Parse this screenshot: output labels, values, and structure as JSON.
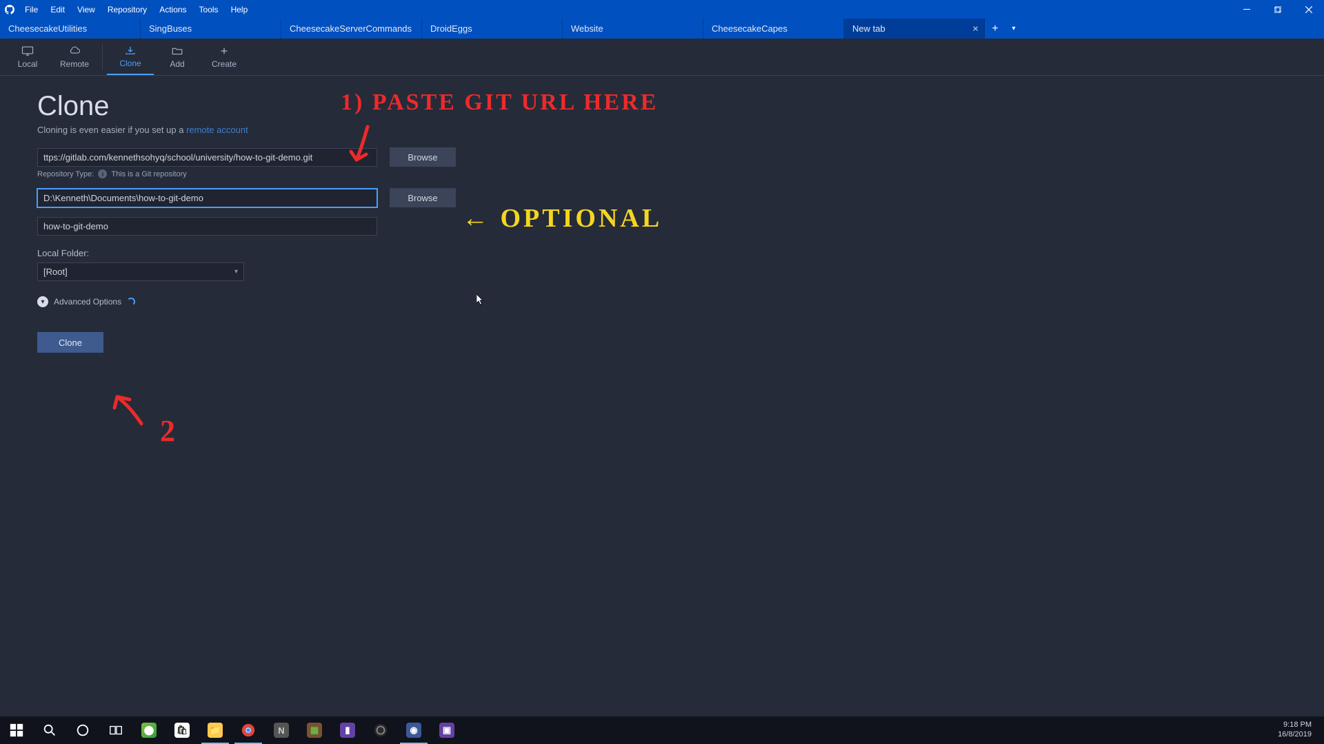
{
  "menubar": [
    "File",
    "Edit",
    "View",
    "Repository",
    "Actions",
    "Tools",
    "Help"
  ],
  "tabs": [
    {
      "label": "CheesecakeUtilities"
    },
    {
      "label": "SingBuses"
    },
    {
      "label": "CheesecakeServerCommands"
    },
    {
      "label": "DroidEggs"
    },
    {
      "label": "Website"
    },
    {
      "label": "CheesecakeCapes"
    },
    {
      "label": "New tab",
      "closable": true
    }
  ],
  "toolbar": {
    "local": "Local",
    "remote": "Remote",
    "clone": "Clone",
    "add": "Add",
    "create": "Create"
  },
  "page": {
    "title": "Clone",
    "subtitle_prefix": "Cloning is even easier if you set up a ",
    "subtitle_link": "remote account",
    "url_value": "ttps://gitlab.com/kennethsohyq/school/university/how-to-git-demo.git",
    "browse1": "Browse",
    "repo_type_label": "Repository Type:",
    "repo_type_desc": "This is a Git repository",
    "dest_value": "D:\\Kenneth\\Documents\\how-to-git-demo",
    "browse2": "Browse",
    "name_value": "how-to-git-demo",
    "local_folder_label": "Local Folder:",
    "root_option": "[Root]",
    "adv_options": "Advanced Options",
    "clone_btn": "Clone"
  },
  "annotations": {
    "a1": "1) PASTE GIT URL HERE",
    "a2": "← OPTIONAL",
    "a3": "2"
  },
  "tray": {
    "time": "9:18 PM",
    "date": "16/8/2019"
  }
}
